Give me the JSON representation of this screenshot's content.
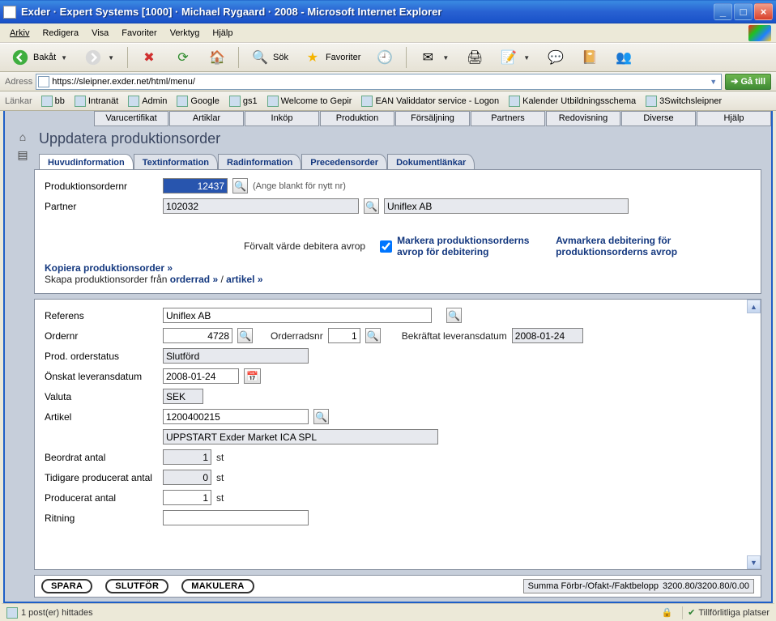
{
  "window": {
    "title": "Exder · Expert Systems [1000] · Michael Rygaard · 2008 - Microsoft Internet Explorer"
  },
  "menubar": [
    "Arkiv",
    "Redigera",
    "Visa",
    "Favoriter",
    "Verktyg",
    "Hjälp"
  ],
  "toolbar": {
    "back": "Bakåt",
    "search": "Sök",
    "favorites": "Favoriter"
  },
  "address": {
    "label": "Adress",
    "value": "https://sleipner.exder.net/html/menu/",
    "go": "Gå till"
  },
  "links": {
    "label": "Länkar",
    "items": [
      "bb",
      "Intranät",
      "Admin",
      "Google",
      "gs1",
      "Welcome to Gepir",
      "EAN Validdator service - Logon",
      "Kalender Utbildningsschema",
      "3Switchsleipner"
    ]
  },
  "apptabs": [
    "Varucertifikat",
    "Artiklar",
    "Inköp",
    "Produktion",
    "Försäljning",
    "Partners",
    "Redovisning",
    "Diverse",
    "Hjälp"
  ],
  "page_title": "Uppdatera produktionsorder",
  "subtabs": [
    "Huvudinformation",
    "Textinformation",
    "Radinformation",
    "Precedensorder",
    "Dokumentlänkar"
  ],
  "upper": {
    "prodordernr_label": "Produktionsordernr",
    "prodordernr": "12437",
    "prodordernr_hint": "(Ange blankt för nytt nr)",
    "partner_label": "Partner",
    "partner_code": "102032",
    "partner_name": "Uniflex AB",
    "forvalt_label": "Förvalt värde debitera avrop",
    "mark_link": "Markera produktionsorderns avrop för debitering",
    "avmark_link": "Avmarkera debitering för produktionsorderns avrop",
    "kopiera": "Kopiera produktionsorder »",
    "skapa_text": "Skapa produktionsorder från ",
    "orderrad_link": "orderrad »",
    "slash": " / ",
    "artikel_link": "artikel »"
  },
  "lower": {
    "referens_label": "Referens",
    "referens": "Uniflex AB",
    "ordernr_label": "Ordernr",
    "ordernr": "4728",
    "orderradsnr_label": "Orderradsnr",
    "orderradsnr": "1",
    "bekr_label": "Bekräftat leveransdatum",
    "bekr": "2008-01-24",
    "status_label": "Prod. orderstatus",
    "status": "Slutförd",
    "onskat_label": "Önskat leveransdatum",
    "onskat": "2008-01-24",
    "valuta_label": "Valuta",
    "valuta": "SEK",
    "artikel_label": "Artikel",
    "artikel_code": "1200400215",
    "artikel_name": "UPPSTART Exder Market ICA SPL",
    "beordrat_label": "Beordrat antal",
    "beordrat": "1",
    "tidigare_label": "Tidigare producerat antal",
    "tidigare": "0",
    "producerat_label": "Producerat antal",
    "producerat": "1",
    "ritning_label": "Ritning",
    "st": "st"
  },
  "actions": {
    "spara": "SPARA",
    "slutfor": "SLUTFÖR",
    "makulera": "MAKULERA",
    "summary_label": "Summa Förbr-/Ofakt-/Faktbelopp",
    "summary_value": "3200.80/3200.80/0.00"
  },
  "status": {
    "left": "1 post(er) hittades",
    "trust": "Tillförlitliga platser"
  }
}
